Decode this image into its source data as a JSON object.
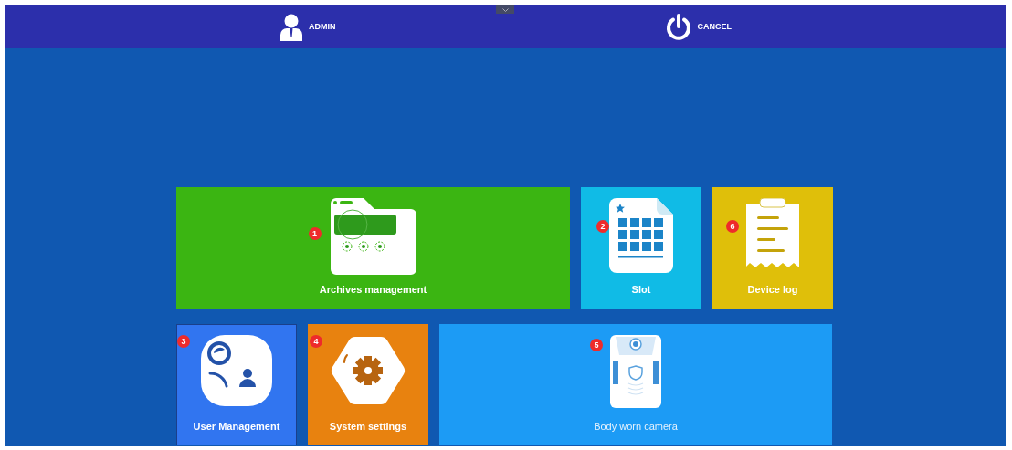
{
  "header": {
    "items": [
      {
        "kind": "user",
        "label": "ADMIN"
      },
      {
        "kind": "power",
        "label": "CANCEL"
      }
    ]
  },
  "tiles": [
    {
      "kind": "archives",
      "badge": "1",
      "label": "Archives management",
      "color": "#3bb512"
    },
    {
      "kind": "slot",
      "badge": "2",
      "label": "Slot",
      "color": "#10bbe6"
    },
    {
      "kind": "log",
      "badge": "6",
      "label": "Device log",
      "color": "#dfbf0a"
    },
    {
      "kind": "users",
      "badge": "3",
      "label": "User Management",
      "color": "#3175f0"
    },
    {
      "kind": "settings",
      "badge": "4",
      "label": "System settings",
      "color": "#e8820f"
    },
    {
      "kind": "camera",
      "badge": "5",
      "label": "Body worn camera",
      "color": "#1c9bf5"
    }
  ]
}
